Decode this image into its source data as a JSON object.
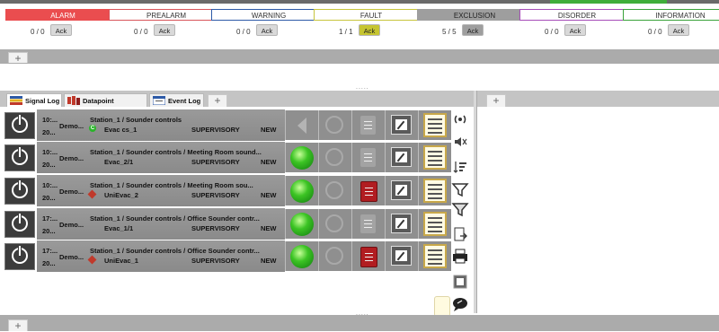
{
  "categories": [
    {
      "name": "ALARM",
      "count": "0 / 0",
      "ack": "Ack",
      "bg": "#ea4d4f",
      "border": "#ea4d4f",
      "text": "#ffffff",
      "ack_bg": "#d9d9d9"
    },
    {
      "name": "PREALARM",
      "count": "0 / 0",
      "ack": "Ack",
      "bg": "#ffffff",
      "border": "#d8545a",
      "text": "#333333",
      "ack_bg": "#d9d9d9"
    },
    {
      "name": "WARNING",
      "count": "0 / 0",
      "ack": "Ack",
      "bg": "#ffffff",
      "border": "#2d5aa7",
      "text": "#333333",
      "ack_bg": "#d9d9d9"
    },
    {
      "name": "FAULT",
      "count": "1 / 1",
      "ack": "Ack",
      "bg": "#ffffff",
      "border": "#c7c43d",
      "text": "#333333",
      "ack_bg": "#c6c531"
    },
    {
      "name": "EXCLUSION",
      "count": "5 / 5",
      "ack": "Ack",
      "bg": "#9e9e9e",
      "border": "#9e9e9e",
      "text": "#222222",
      "ack_bg": "#9e9e9e"
    },
    {
      "name": "DISORDER",
      "count": "0 / 0",
      "ack": "Ack",
      "bg": "#ffffff",
      "border": "#a64cb8",
      "text": "#333333",
      "ack_bg": "#d9d9d9"
    },
    {
      "name": "INFORMATION",
      "count": "0 / 0",
      "ack": "Ack",
      "bg": "#ffffff",
      "border": "#3aa23a",
      "text": "#333333",
      "ack_bg": "#d9d9d9"
    }
  ],
  "tabs": {
    "add": "+",
    "signal_log": "Signal Log",
    "datapoint_hierarchy": "Datapoint Hierarchy",
    "event_log": "Event Log",
    "grip": "....."
  },
  "log_rows": [
    {
      "time": "10:...",
      "date": "20...",
      "site": "Demo...",
      "title": "Station_1 / Sounder controls",
      "device": "Evac cs_1",
      "device_icon": "green-c-icon",
      "type": "SUPERVISORY",
      "status": "NEW",
      "ball": false,
      "nav": true,
      "doc_red": false
    },
    {
      "time": "10:...",
      "date": "20...",
      "site": "Demo...",
      "title": "Station_1 / Sounder controls / Meeting Room sound...",
      "device": "Evac_2/1",
      "device_icon": "",
      "type": "SUPERVISORY",
      "status": "NEW",
      "ball": true,
      "nav": false,
      "doc_red": false
    },
    {
      "time": "10:...",
      "date": "20...",
      "site": "Demo...",
      "title": "Station_1 / Sounder controls / Meeting Room sou...",
      "device": "UniEvac_2",
      "device_icon": "red-x-icon",
      "type": "SUPERVISORY",
      "status": "NEW",
      "ball": true,
      "nav": false,
      "doc_red": true
    },
    {
      "time": "17:...",
      "date": "20...",
      "site": "Demo...",
      "title": "Station_1 / Sounder controls / Office Sounder contr...",
      "device": "Evac_1/1",
      "device_icon": "",
      "type": "SUPERVISORY",
      "status": "NEW",
      "ball": true,
      "nav": false,
      "doc_red": false
    },
    {
      "time": "17:...",
      "date": "20...",
      "site": "Demo...",
      "title": "Station_1 / Sounder controls / Office Sounder contr...",
      "device": "UniEvac_1",
      "device_icon": "red-x-icon",
      "type": "SUPERVISORY",
      "status": "NEW",
      "ball": true,
      "nav": false,
      "doc_red": true
    }
  ],
  "toolbar_icons": [
    "broadcast-icon",
    "speaker-mute-icon",
    "sort-icon",
    "filter-icon",
    "filter-clear-icon",
    "export-icon",
    "print-icon",
    "edit-icon",
    "comment-icon"
  ]
}
